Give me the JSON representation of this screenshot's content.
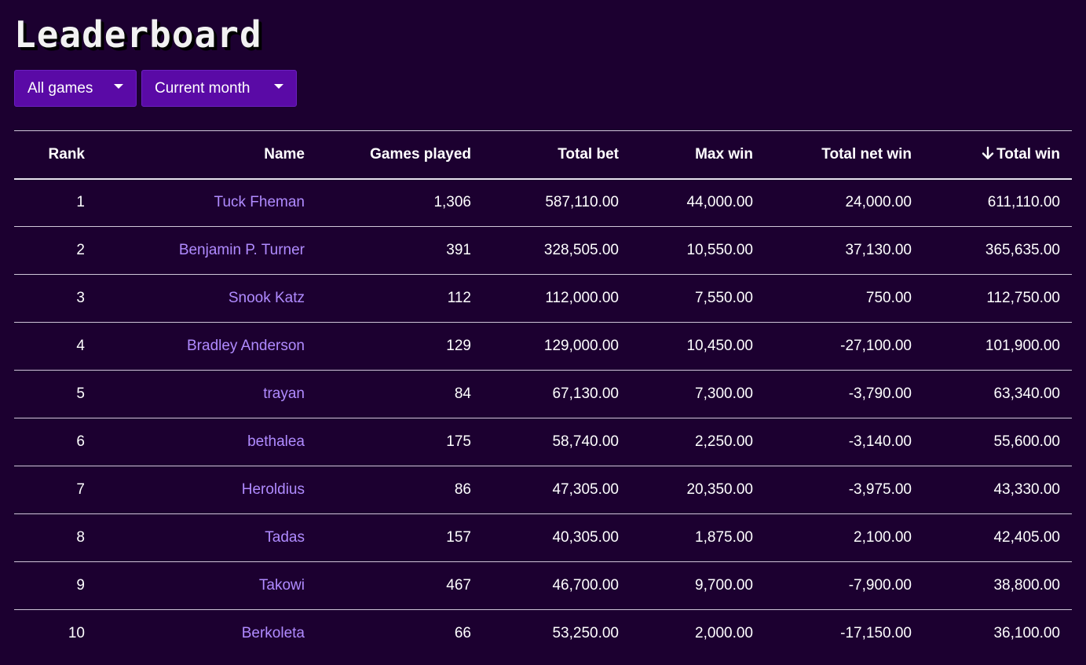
{
  "page": {
    "title": "Leaderboard"
  },
  "filters": {
    "game": {
      "selected": "All games"
    },
    "period": {
      "selected": "Current month"
    }
  },
  "table": {
    "columns": {
      "rank": "Rank",
      "name": "Name",
      "games_played": "Games played",
      "total_bet": "Total bet",
      "max_win": "Max win",
      "total_net_win": "Total net win",
      "total_win": "Total win"
    },
    "sorted_by": "total_win",
    "sort_direction": "descending",
    "rows": [
      {
        "rank": "1",
        "name": "Tuck Fheman",
        "games_played": "1,306",
        "total_bet": "587,110.00",
        "max_win": "44,000.00",
        "total_net_win": "24,000.00",
        "total_win": "611,110.00"
      },
      {
        "rank": "2",
        "name": "Benjamin P. Turner",
        "games_played": "391",
        "total_bet": "328,505.00",
        "max_win": "10,550.00",
        "total_net_win": "37,130.00",
        "total_win": "365,635.00"
      },
      {
        "rank": "3",
        "name": "Snook Katz",
        "games_played": "112",
        "total_bet": "112,000.00",
        "max_win": "7,550.00",
        "total_net_win": "750.00",
        "total_win": "112,750.00"
      },
      {
        "rank": "4",
        "name": "Bradley Anderson",
        "games_played": "129",
        "total_bet": "129,000.00",
        "max_win": "10,450.00",
        "total_net_win": "-27,100.00",
        "total_win": "101,900.00"
      },
      {
        "rank": "5",
        "name": "trayan",
        "games_played": "84",
        "total_bet": "67,130.00",
        "max_win": "7,300.00",
        "total_net_win": "-3,790.00",
        "total_win": "63,340.00"
      },
      {
        "rank": "6",
        "name": "bethalea",
        "games_played": "175",
        "total_bet": "58,740.00",
        "max_win": "2,250.00",
        "total_net_win": "-3,140.00",
        "total_win": "55,600.00"
      },
      {
        "rank": "7",
        "name": "Heroldius",
        "games_played": "86",
        "total_bet": "47,305.00",
        "max_win": "20,350.00",
        "total_net_win": "-3,975.00",
        "total_win": "43,330.00"
      },
      {
        "rank": "8",
        "name": "Tadas",
        "games_played": "157",
        "total_bet": "40,305.00",
        "max_win": "1,875.00",
        "total_net_win": "2,100.00",
        "total_win": "42,405.00"
      },
      {
        "rank": "9",
        "name": "Takowi",
        "games_played": "467",
        "total_bet": "46,700.00",
        "max_win": "9,700.00",
        "total_net_win": "-7,900.00",
        "total_win": "38,800.00"
      },
      {
        "rank": "10",
        "name": "Berkoleta",
        "games_played": "66",
        "total_bet": "53,250.00",
        "max_win": "2,000.00",
        "total_net_win": "-17,150.00",
        "total_win": "36,100.00"
      }
    ]
  },
  "icons": {
    "dropdown_caret": "caret-down-icon",
    "sort": "arrow-down-icon"
  },
  "colors": {
    "background": "#1c0030",
    "dropdown_bg": "#5a0aa6",
    "link": "#b08bff",
    "text": "#ffffff"
  }
}
